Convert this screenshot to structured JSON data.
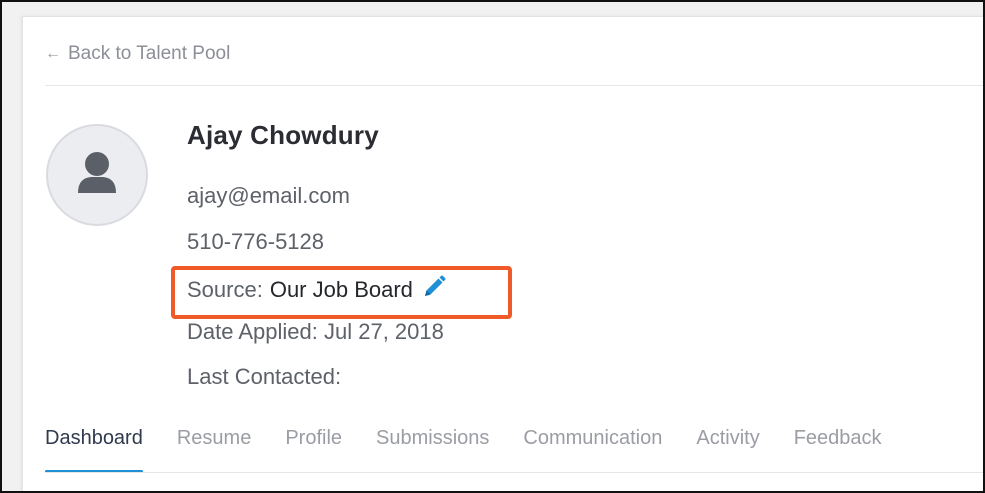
{
  "nav": {
    "back_label": "Back to Talent Pool",
    "back_icon": "arrow-left-icon"
  },
  "candidate": {
    "name": "Ajay Chowdury",
    "email": "ajay@email.com",
    "phone": "510-776-5128",
    "source_label": "Source:",
    "source_value": "Our Job Board",
    "source_edit_icon": "pencil-icon",
    "date_applied": "Date Applied: Jul 27, 2018",
    "last_contacted": "Last Contacted:",
    "avatar_icon": "user-silhouette-icon"
  },
  "tabs": [
    {
      "label": "Dashboard",
      "active": true
    },
    {
      "label": "Resume",
      "active": false
    },
    {
      "label": "Profile",
      "active": false
    },
    {
      "label": "Submissions",
      "active": false
    },
    {
      "label": "Communication",
      "active": false
    },
    {
      "label": "Activity",
      "active": false
    },
    {
      "label": "Feedback",
      "active": false
    }
  ],
  "colors": {
    "highlight_border": "#f05a28",
    "active_tab_underline": "#1f8fd6",
    "edit_icon": "#1f8fd6"
  }
}
